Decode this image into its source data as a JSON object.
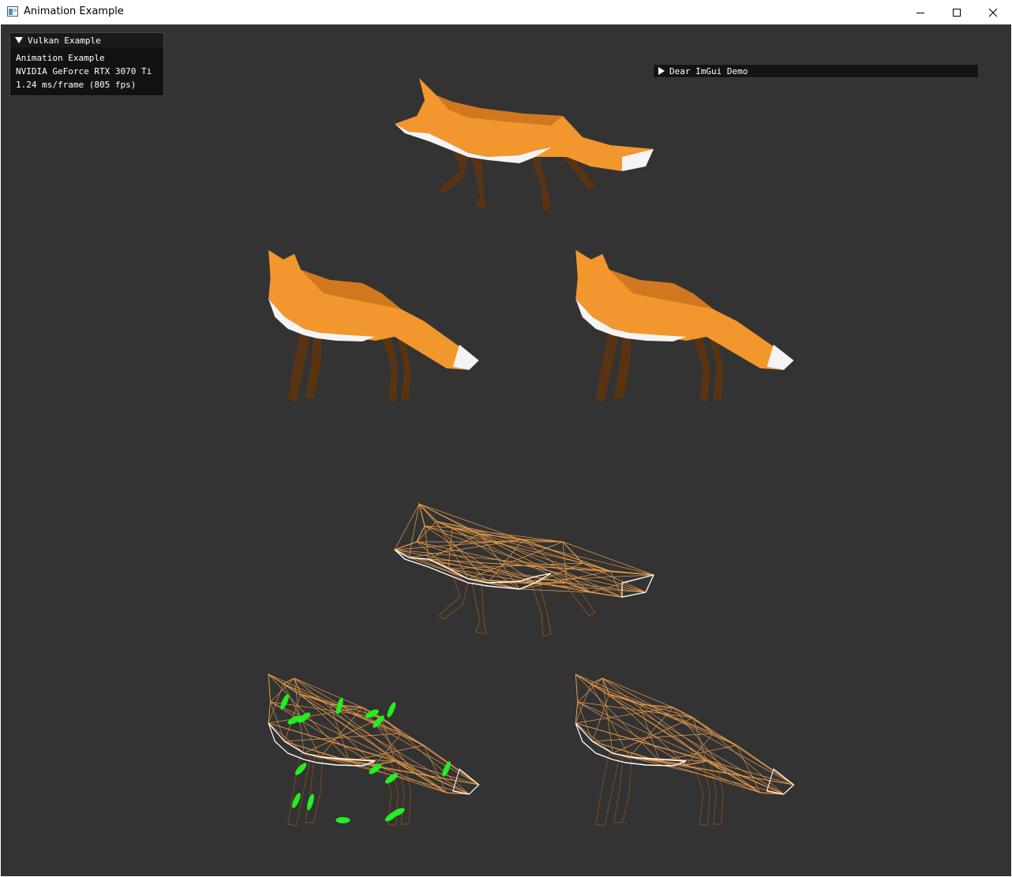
{
  "window": {
    "title": "Animation Example",
    "app_icon": "window-app-icon",
    "controls": [
      "minimize-icon",
      "maximize-icon",
      "close-icon"
    ]
  },
  "overlay": {
    "header": "Vulkan Example",
    "lines": [
      "Animation Example",
      "NVIDIA GeForce RTX 3070 Ti",
      "1.24 ms/frame (805 fps)"
    ]
  },
  "demo_window": {
    "label": "Dear ImGui Demo"
  },
  "scene": {
    "background": "#333333",
    "fox_colors": {
      "body": "#f2962e",
      "shade": "#c8701c",
      "belly": "#f4f4f4",
      "legs": "#5a3412"
    },
    "wire_colors": {
      "body": "#e89a4a",
      "belly": "#ffffff",
      "legs": "#7a4a1e",
      "joints": "#22ee22"
    },
    "models": [
      {
        "name": "fox-solid-walk",
        "style": "solid"
      },
      {
        "name": "fox-solid-stand-left",
        "style": "solid"
      },
      {
        "name": "fox-solid-stand-right",
        "style": "solid"
      },
      {
        "name": "fox-wire-walk",
        "style": "wireframe"
      },
      {
        "name": "fox-wire-joints",
        "style": "wireframe-with-joints"
      },
      {
        "name": "fox-wire-stand",
        "style": "wireframe"
      }
    ]
  }
}
